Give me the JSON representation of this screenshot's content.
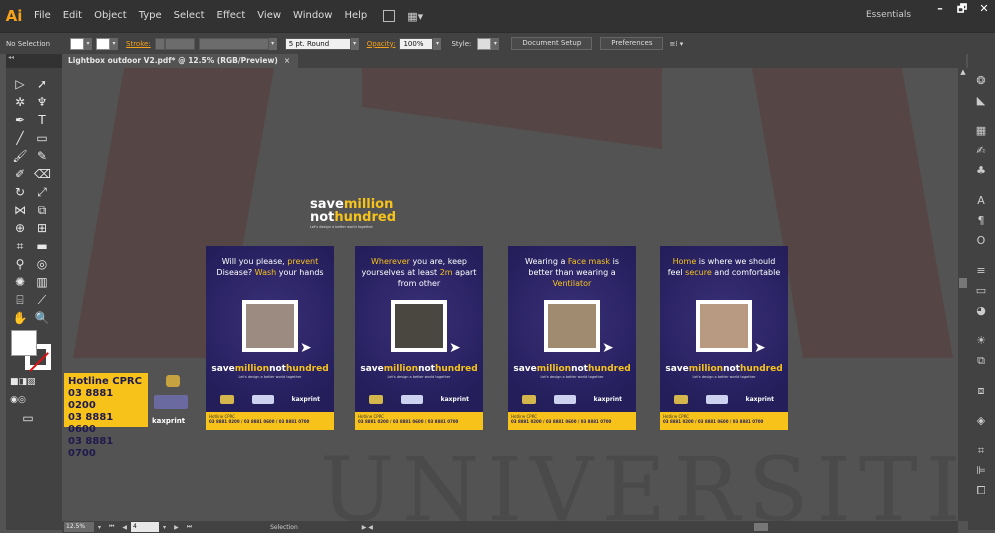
{
  "app": {
    "logo": "Ai",
    "menu": [
      "File",
      "Edit",
      "Object",
      "Type",
      "Select",
      "Effect",
      "View",
      "Window",
      "Help"
    ],
    "workspace": "Essentials",
    "window_buttons": [
      "–",
      "🗗",
      "✕"
    ]
  },
  "control_bar": {
    "selection": "No Selection",
    "stroke_label": "Stroke:",
    "brush": "5 pt. Round",
    "opacity_label": "Opacity:",
    "opacity_value": "100%",
    "style_label": "Style:",
    "document_setup": "Document Setup",
    "preferences": "Preferences"
  },
  "document_tab": {
    "title": "Lightbox outdoor V2.pdf* @ 12.5% (RGB/Preview)",
    "close": "×"
  },
  "artwork": {
    "logo_top": {
      "line1_a": "save",
      "line1_b": "million",
      "line2_a": "not",
      "line2_b": "hundred",
      "tagline": "Let's design a better world together"
    },
    "posters": [
      {
        "head_parts": [
          "Will you please, ",
          "prevent",
          " Disease? ",
          "Wash",
          " your hands"
        ]
      },
      {
        "head_parts": [
          "Wherever",
          " you are, keep yourselves at least ",
          "2m",
          " apart from other"
        ]
      },
      {
        "head_parts": [
          "Wearing a ",
          "Face mask",
          " is better than wearing a ",
          "Ventilator",
          ""
        ]
      },
      {
        "head_parts": [
          "Home",
          " is where we should feel ",
          "secure",
          " and comfortable"
        ]
      }
    ],
    "poster_brand": {
      "a": "save",
      "b": "million",
      "c": "not",
      "d": "hundred"
    },
    "poster_tagline": "Let's design a better world together",
    "poster_kax": "kaxprint",
    "poster_footer_1": "Hotline CPRC",
    "poster_footer_2": "03 8881 0200 / 03 8881 0600 / 03 8881 0700",
    "hotline_box": {
      "title": "Hotline CPRC",
      "lines": [
        "03 8881 0200",
        "03 8881 0600",
        "03 8881 0700"
      ]
    },
    "side_kax": "kaxprint"
  },
  "status_bar": {
    "zoom": "12.5%",
    "page": "4",
    "status": "Selection"
  },
  "colors": {
    "accent": "#f7a21b",
    "poster_bg": "#241e5b",
    "highlight": "#f7c31b"
  }
}
